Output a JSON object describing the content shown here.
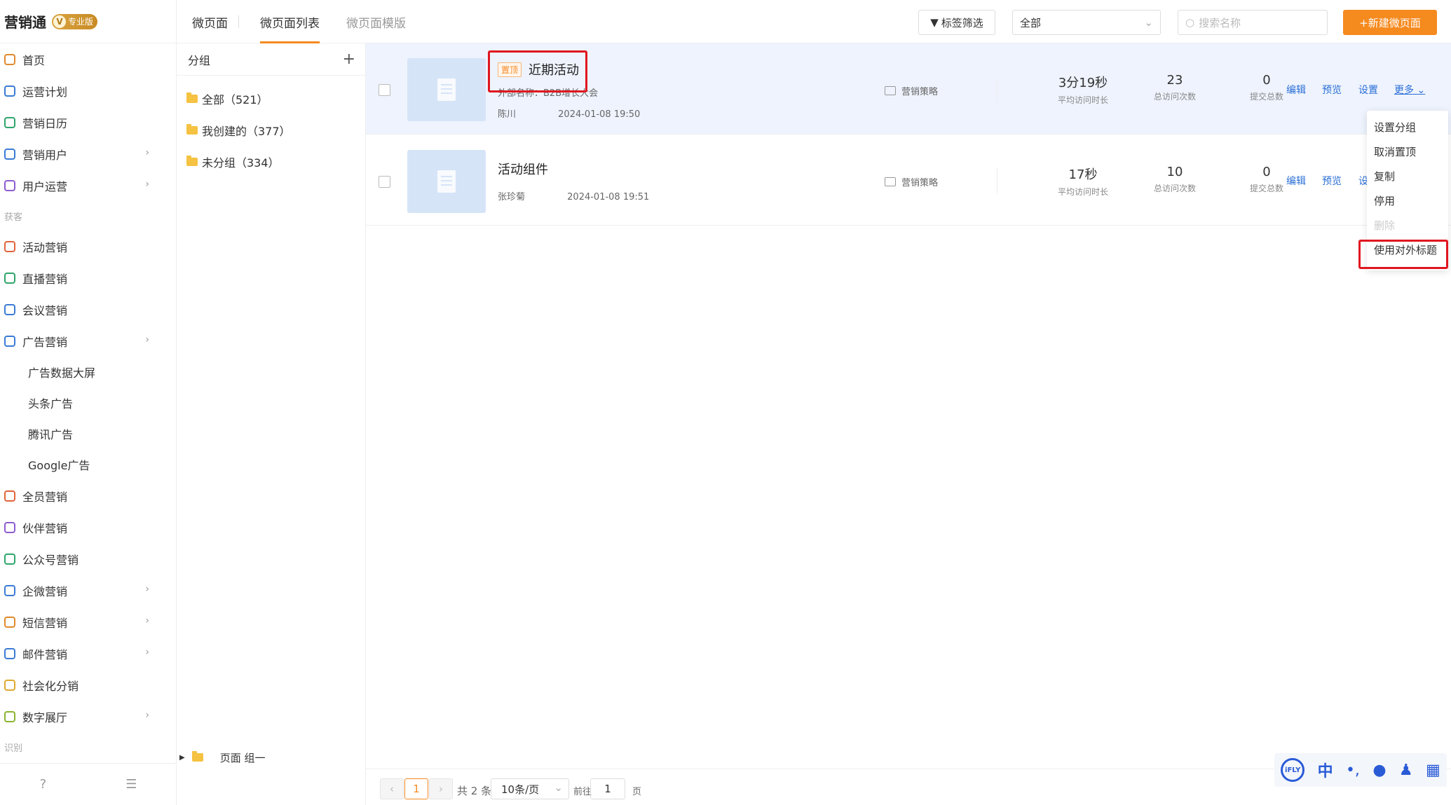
{
  "brand": {
    "name": "营销通",
    "badge": "专业版",
    "badge_v": "V"
  },
  "sidebar": {
    "items_top": [
      {
        "label": "首页",
        "icon": "home-icon",
        "color": "#e08a2e",
        "chevron": false
      },
      {
        "label": "运营计划",
        "icon": "flag-icon",
        "color": "#3a7bd5",
        "chevron": false
      },
      {
        "label": "营销日历",
        "icon": "calendar-icon",
        "color": "#2fa56b",
        "chevron": false
      },
      {
        "label": "营销用户",
        "icon": "users-icon",
        "color": "#3a7bd5",
        "chevron": true
      },
      {
        "label": "用户运营",
        "icon": "user-ops-icon",
        "color": "#8e5bd0",
        "chevron": true
      }
    ],
    "section_label": "获客",
    "items_acq": [
      {
        "label": "活动营销",
        "icon": "activity-icon",
        "color": "#e0643a",
        "chevron": false
      },
      {
        "label": "直播营销",
        "icon": "live-icon",
        "color": "#2fa56b",
        "chevron": false
      },
      {
        "label": "会议营销",
        "icon": "meeting-icon",
        "color": "#3a7bd5",
        "chevron": false
      },
      {
        "label": "广告营销",
        "icon": "ad-icon",
        "color": "#3a7bd5",
        "chevron": true
      }
    ],
    "ad_sub": [
      "广告数据大屏",
      "头条广告",
      "腾讯广告",
      "Google广告"
    ],
    "items_bottom": [
      {
        "label": "全员营销",
        "icon": "all-staff-icon",
        "color": "#e0643a",
        "chevron": false
      },
      {
        "label": "伙伴营销",
        "icon": "partner-icon",
        "color": "#8e5bd0",
        "chevron": false
      },
      {
        "label": "公众号营销",
        "icon": "wechat-icon",
        "color": "#2fa56b",
        "chevron": false
      },
      {
        "label": "企微营销",
        "icon": "wecom-icon",
        "color": "#3a7bd5",
        "chevron": true
      },
      {
        "label": "短信营销",
        "icon": "sms-icon",
        "color": "#e08a2e",
        "chevron": true
      },
      {
        "label": "邮件营销",
        "icon": "mail-icon",
        "color": "#3a7bd5",
        "chevron": true
      },
      {
        "label": "社会化分销",
        "icon": "distribution-icon",
        "color": "#e0a82e",
        "chevron": false
      },
      {
        "label": "数字展厅",
        "icon": "showroom-icon",
        "color": "#8ab42e",
        "chevron": true
      }
    ],
    "section_label_2": "识别"
  },
  "tabs": [
    {
      "label": "微页面",
      "state": "normal"
    },
    {
      "label": "微页面列表",
      "state": "active"
    },
    {
      "label": "微页面模版",
      "state": "dim"
    }
  ],
  "toolbar": {
    "filter_label": "标签筛选",
    "select_value": "全部",
    "search_placeholder": "搜索名称",
    "new_button": "+新建微页面"
  },
  "groups": {
    "title": "分组",
    "items": [
      {
        "label": "全部（521）"
      },
      {
        "label": "我创建的（377）"
      },
      {
        "label": "未分组（334）"
      }
    ],
    "bottom_item": "页面 组一"
  },
  "rows": [
    {
      "pin_tag": "置顶",
      "title": "近期活动",
      "external_name": "外部名称：B2B增长大会",
      "author": "陈川",
      "date": "2024-01-08 19:50",
      "strategy": "营销策略",
      "avg_duration": "3分19秒",
      "avg_duration_label": "平均访问时长",
      "visits": "23",
      "visits_label": "总访问次数",
      "submits": "0",
      "submits_label": "提交总数",
      "actions": [
        "编辑",
        "预览",
        "设置",
        "更多"
      ]
    },
    {
      "title": "活动组件",
      "author": "张珍菊",
      "date": "2024-01-08 19:51",
      "strategy": "营销策略",
      "avg_duration": "17秒",
      "avg_duration_label": "平均访问时长",
      "visits": "10",
      "visits_label": "总访问次数",
      "submits": "0",
      "submits_label": "提交总数",
      "actions": [
        "编辑",
        "预览",
        "设"
      ]
    }
  ],
  "more_menu": [
    "设置分组",
    "取消置顶",
    "复制",
    "停用",
    "删除",
    "使用对外标题"
  ],
  "pagination": {
    "current": "1",
    "total": "共 2 条",
    "page_size": "10条/页",
    "goto_prefix": "前往",
    "goto_value": "1",
    "goto_suffix": "页"
  },
  "ime_bar": {
    "logo": "iFLY",
    "lang": "中"
  },
  "colors": {
    "accent": "#f58a1f",
    "link": "#2b6fd6",
    "highlight_box": "#e0161f"
  }
}
